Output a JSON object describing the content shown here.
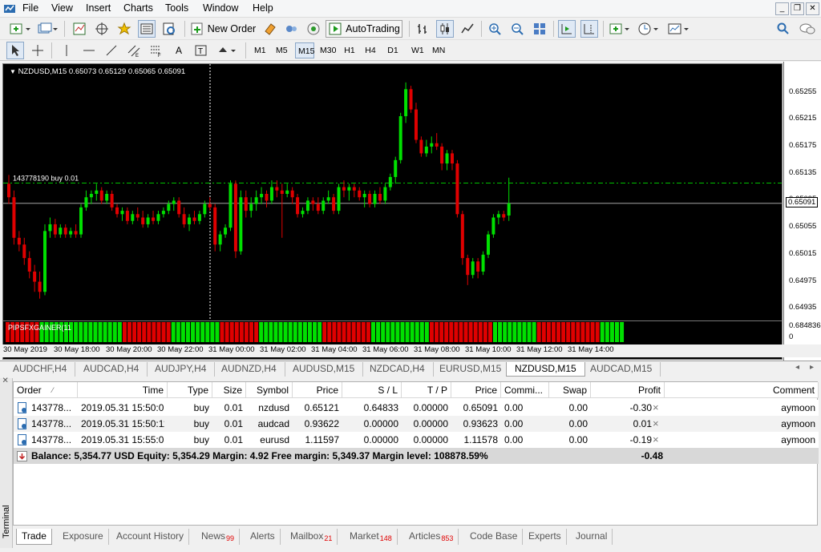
{
  "menu": {
    "items": [
      "File",
      "View",
      "Insert",
      "Charts",
      "Tools",
      "Window",
      "Help"
    ]
  },
  "toolbar": {
    "new_order_label": "New Order",
    "autotrading_label": "AutoTrading"
  },
  "timeframes": [
    "M1",
    "M5",
    "M15",
    "M30",
    "H1",
    "H4",
    "D1",
    "W1",
    "MN"
  ],
  "active_timeframe": "M15",
  "chart": {
    "title": "NZDUSD,M15  0.65073 0.65129 0.65065 0.65091",
    "order_line_label": "143778190 buy 0.01",
    "indicator_label": "PIPSFXGAINER(11",
    "current_price": "0.65091",
    "price_ticks": [
      "0.65255",
      "0.65215",
      "0.65175",
      "0.65135",
      "0.65095",
      "0.65055",
      "0.65015",
      "0.64975",
      "0.64935"
    ],
    "indicator_ticks": [
      "0.684836",
      "0"
    ],
    "time_labels": [
      "30 May 2019",
      "30 May 18:00",
      "30 May 20:00",
      "30 May 22:00",
      "31 May 00:00",
      "31 May 02:00",
      "31 May 04:00",
      "31 May 06:00",
      "31 May 08:00",
      "31 May 10:00",
      "31 May 12:00",
      "31 May 14:00"
    ],
    "up_color": "#00e000",
    "down_color": "#e00000"
  },
  "chart_data": {
    "type": "candlestick",
    "symbol": "NZDUSD",
    "timeframe": "M15",
    "ylim": [
      0.6492,
      0.6529
    ],
    "order_price": 0.65121,
    "current_price": 0.65091,
    "candles": [
      [
        0.6512,
        0.65133,
        0.6509,
        0.651
      ],
      [
        0.651,
        0.6511,
        0.6503,
        0.6504
      ],
      [
        0.6504,
        0.6505,
        0.6502,
        0.6503
      ],
      [
        0.6503,
        0.6504,
        0.65,
        0.6501
      ],
      [
        0.6501,
        0.6502,
        0.6498,
        0.6499
      ],
      [
        0.6499,
        0.65,
        0.6496,
        0.64975
      ],
      [
        0.64975,
        0.6499,
        0.6495,
        0.6496
      ],
      [
        0.6496,
        0.6506,
        0.64955,
        0.6505
      ],
      [
        0.6505,
        0.6507,
        0.6504,
        0.6506
      ],
      [
        0.6506,
        0.65068,
        0.6504,
        0.65045
      ],
      [
        0.65045,
        0.6506,
        0.6504,
        0.65055
      ],
      [
        0.65055,
        0.6506,
        0.6504,
        0.65045
      ],
      [
        0.65045,
        0.65055,
        0.6504,
        0.6505
      ],
      [
        0.6505,
        0.6506,
        0.6504,
        0.65045
      ],
      [
        0.65045,
        0.6509,
        0.6504,
        0.65085
      ],
      [
        0.65085,
        0.6511,
        0.6508,
        0.651
      ],
      [
        0.651,
        0.6511,
        0.6509,
        0.65105
      ],
      [
        0.65105,
        0.6512,
        0.65095,
        0.6511
      ],
      [
        0.6511,
        0.65115,
        0.6509,
        0.65095
      ],
      [
        0.65095,
        0.6511,
        0.6509,
        0.65105
      ],
      [
        0.65105,
        0.6511,
        0.6508,
        0.65085
      ],
      [
        0.65085,
        0.6509,
        0.6507,
        0.65075
      ],
      [
        0.65075,
        0.65085,
        0.65065,
        0.6508
      ],
      [
        0.6508,
        0.65085,
        0.6506,
        0.65065
      ],
      [
        0.65065,
        0.6508,
        0.6506,
        0.65075
      ],
      [
        0.65075,
        0.65085,
        0.65065,
        0.6507
      ],
      [
        0.6507,
        0.6508,
        0.65055,
        0.6506
      ],
      [
        0.6506,
        0.65075,
        0.65055,
        0.6507
      ],
      [
        0.6507,
        0.6508,
        0.6506,
        0.65065
      ],
      [
        0.65065,
        0.6508,
        0.6506,
        0.65075
      ],
      [
        0.65075,
        0.65085,
        0.6507,
        0.6508
      ],
      [
        0.6508,
        0.65095,
        0.65075,
        0.6509
      ],
      [
        0.6509,
        0.651,
        0.6508,
        0.65095
      ],
      [
        0.65095,
        0.651,
        0.6507,
        0.65075
      ],
      [
        0.65075,
        0.65085,
        0.65055,
        0.6506
      ],
      [
        0.6506,
        0.65075,
        0.6505,
        0.6507
      ],
      [
        0.6507,
        0.6508,
        0.6506,
        0.65065
      ],
      [
        0.65065,
        0.6508,
        0.6506,
        0.65075
      ],
      [
        0.65075,
        0.65095,
        0.6507,
        0.6509
      ],
      [
        0.6509,
        0.651,
        0.6508,
        0.65085
      ],
      [
        0.65085,
        0.6509,
        0.6502,
        0.6503
      ],
      [
        0.6503,
        0.6505,
        0.6502,
        0.65045
      ],
      [
        0.65045,
        0.6506,
        0.6504,
        0.65055
      ],
      [
        0.65055,
        0.65125,
        0.6505,
        0.6512
      ],
      [
        0.6512,
        0.65125,
        0.6501,
        0.6502
      ],
      [
        0.6502,
        0.6511,
        0.65015,
        0.651
      ],
      [
        0.651,
        0.6511,
        0.6507,
        0.6508
      ],
      [
        0.6508,
        0.651,
        0.6507,
        0.6509
      ],
      [
        0.6509,
        0.6511,
        0.6508,
        0.651
      ],
      [
        0.651,
        0.65115,
        0.6509,
        0.65105
      ],
      [
        0.65105,
        0.6511,
        0.65085,
        0.65095
      ],
      [
        0.65095,
        0.65125,
        0.6509,
        0.65115
      ],
      [
        0.65115,
        0.65125,
        0.651,
        0.6511
      ],
      [
        0.6511,
        0.6512,
        0.6504,
        0.65105
      ],
      [
        0.65105,
        0.6512,
        0.651,
        0.6511
      ],
      [
        0.6511,
        0.65115,
        0.6509,
        0.651
      ],
      [
        0.651,
        0.65105,
        0.6507,
        0.65075
      ],
      [
        0.65075,
        0.65085,
        0.6507,
        0.6508
      ],
      [
        0.6508,
        0.651,
        0.65075,
        0.65095
      ],
      [
        0.65095,
        0.651,
        0.6508,
        0.6509
      ],
      [
        0.6509,
        0.651,
        0.65075,
        0.6508
      ],
      [
        0.6508,
        0.651,
        0.65075,
        0.65095
      ],
      [
        0.65095,
        0.6511,
        0.6509,
        0.651
      ],
      [
        0.651,
        0.65105,
        0.65075,
        0.6508
      ],
      [
        0.6508,
        0.6512,
        0.65075,
        0.65115
      ],
      [
        0.65115,
        0.65125,
        0.651,
        0.6511
      ],
      [
        0.6511,
        0.6512,
        0.65095,
        0.65115
      ],
      [
        0.65115,
        0.6512,
        0.651,
        0.6511
      ],
      [
        0.6511,
        0.65115,
        0.65095,
        0.651
      ],
      [
        0.651,
        0.6511,
        0.65085,
        0.65105
      ],
      [
        0.65105,
        0.6511,
        0.65085,
        0.6509
      ],
      [
        0.6509,
        0.6511,
        0.65085,
        0.65105
      ],
      [
        0.65105,
        0.65115,
        0.6509,
        0.65095
      ],
      [
        0.65095,
        0.6512,
        0.6509,
        0.65115
      ],
      [
        0.65115,
        0.65135,
        0.6511,
        0.6513
      ],
      [
        0.6513,
        0.6516,
        0.6512,
        0.65155
      ],
      [
        0.65155,
        0.65225,
        0.6515,
        0.6522
      ],
      [
        0.6522,
        0.6527,
        0.6521,
        0.6526
      ],
      [
        0.6526,
        0.65265,
        0.65225,
        0.6523
      ],
      [
        0.6523,
        0.6524,
        0.6518,
        0.65185
      ],
      [
        0.65185,
        0.6519,
        0.6516,
        0.65165
      ],
      [
        0.65165,
        0.65185,
        0.6516,
        0.65175
      ],
      [
        0.65175,
        0.6519,
        0.65165,
        0.6518
      ],
      [
        0.6518,
        0.65195,
        0.6517,
        0.65175
      ],
      [
        0.65175,
        0.6518,
        0.6514,
        0.6515
      ],
      [
        0.6515,
        0.6517,
        0.6514,
        0.65165
      ],
      [
        0.65165,
        0.6517,
        0.6514,
        0.6515
      ],
      [
        0.6515,
        0.65155,
        0.6507,
        0.65075
      ],
      [
        0.65075,
        0.6508,
        0.65,
        0.6501
      ],
      [
        0.6501,
        0.65015,
        0.6497,
        0.64985
      ],
      [
        0.64985,
        0.6501,
        0.6498,
        0.65005
      ],
      [
        0.65005,
        0.6501,
        0.6498,
        0.6499
      ],
      [
        0.6499,
        0.6502,
        0.64985,
        0.65015
      ],
      [
        0.65015,
        0.6505,
        0.6501,
        0.65045
      ],
      [
        0.65045,
        0.65075,
        0.6504,
        0.6507
      ],
      [
        0.6507,
        0.6508,
        0.6506,
        0.65075
      ],
      [
        0.65075,
        0.6508,
        0.65065,
        0.6507
      ],
      [
        0.65073,
        0.65129,
        0.65065,
        0.65091
      ]
    ],
    "indicator_colors": "rrrrrrrgggggggggggggggggrrrrrrrrrrggggggggggrrrrrrrrgggggggggggggrrrrrrrrrrggggggggggggrrrrrrrrrrrrrgggggggggrrrrrrrrrrrrrggggg"
  },
  "symbol_tabs": [
    "AUDCHF,H4",
    "AUDCAD,H4",
    "AUDJPY,H4",
    "AUDNZD,H4",
    "AUDUSD,M15",
    "NZDCAD,H4",
    "EURUSD,M15",
    "NZDUSD,M15",
    "AUDCAD,M15"
  ],
  "active_symbol_tab": "NZDUSD,M15",
  "terminal": {
    "side_label": "Terminal",
    "columns": [
      "Order",
      "Time",
      "Type",
      "Size",
      "Symbol",
      "Price",
      "S / L",
      "T / P",
      "Price",
      "Commi...",
      "Swap",
      "Profit",
      "Comment"
    ],
    "rows": [
      {
        "order": "143778...",
        "time": "2019.05.31 15:50:09",
        "type": "buy",
        "size": "0.01",
        "symbol": "nzdusd",
        "price": "0.65121",
        "sl": "0.64833",
        "tp": "0.00000",
        "cur": "0.65091",
        "comm": "0.00",
        "swap": "0.00",
        "profit": "-0.30",
        "comment": "aymoon"
      },
      {
        "order": "143778...",
        "time": "2019.05.31 15:50:11",
        "type": "buy",
        "size": "0.01",
        "symbol": "audcad",
        "price": "0.93622",
        "sl": "0.00000",
        "tp": "0.00000",
        "cur": "0.93623",
        "comm": "0.00",
        "swap": "0.00",
        "profit": "0.01",
        "comment": "aymoon"
      },
      {
        "order": "143778...",
        "time": "2019.05.31 15:55:08",
        "type": "buy",
        "size": "0.01",
        "symbol": "eurusd",
        "price": "1.11597",
        "sl": "0.00000",
        "tp": "0.00000",
        "cur": "1.11578",
        "comm": "0.00",
        "swap": "0.00",
        "profit": "-0.19",
        "comment": "aymoon"
      }
    ],
    "balance_line": "Balance: 5,354.77 USD  Equity: 5,354.29  Margin: 4.92  Free margin: 5,349.37  Margin level: 108878.59%",
    "total_profit": "-0.48",
    "tabs": [
      {
        "label": "Trade",
        "badge": ""
      },
      {
        "label": "Exposure",
        "badge": ""
      },
      {
        "label": "Account History",
        "badge": ""
      },
      {
        "label": "News",
        "badge": "99"
      },
      {
        "label": "Alerts",
        "badge": ""
      },
      {
        "label": "Mailbox",
        "badge": "21"
      },
      {
        "label": "Market",
        "badge": "148"
      },
      {
        "label": "Articles",
        "badge": "853"
      },
      {
        "label": "Code Base",
        "badge": ""
      },
      {
        "label": "Experts",
        "badge": ""
      },
      {
        "label": "Journal",
        "badge": ""
      }
    ],
    "active_tab": "Trade"
  }
}
